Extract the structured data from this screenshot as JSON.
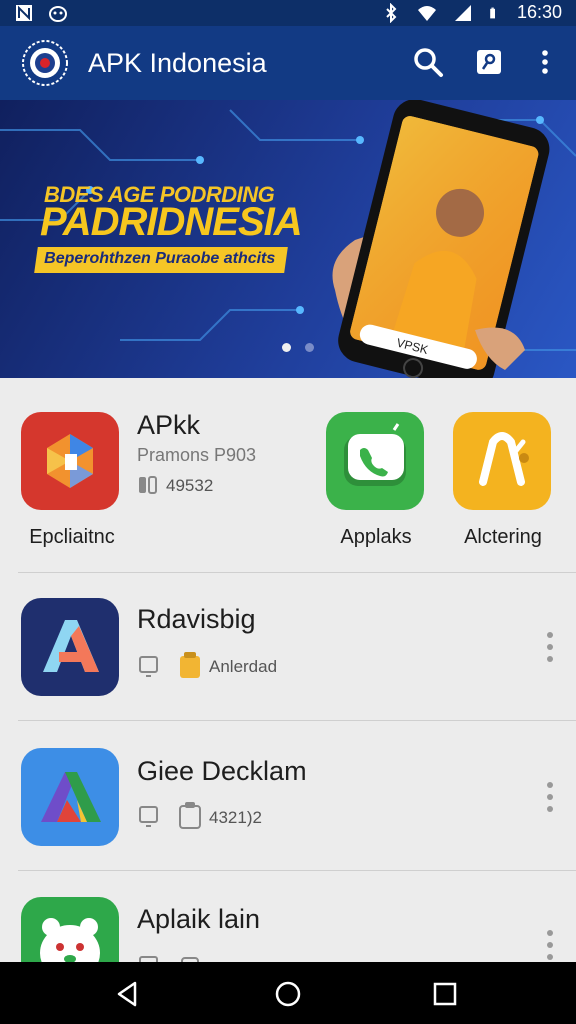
{
  "status_bar": {
    "time": "16:30"
  },
  "app_bar": {
    "title": "APK Indonesia"
  },
  "banner": {
    "line1": "BDES AGE PODRDING",
    "line2": "PADRIDNESIA",
    "line3": "Beperohthzen Puraobe athcits",
    "phone_caption": "VPSK"
  },
  "featured": {
    "primary": {
      "name": "APkk",
      "subtitle": "Pramons P903",
      "meta": "49532",
      "label": "Epcliaitnc"
    },
    "others": [
      {
        "label": "Applaks"
      },
      {
        "label": "Alctering"
      }
    ]
  },
  "list": [
    {
      "name": "Rdavisbig",
      "meta": "Anlerdad"
    },
    {
      "name": "Giee Decklam",
      "meta": "4321)2"
    },
    {
      "name": "Aplaik lain",
      "meta": ""
    }
  ],
  "colors": {
    "status_bar": "#0d2f68",
    "app_bar": "#123a84",
    "banner_accent": "#f5c526",
    "background": "#ececec"
  }
}
